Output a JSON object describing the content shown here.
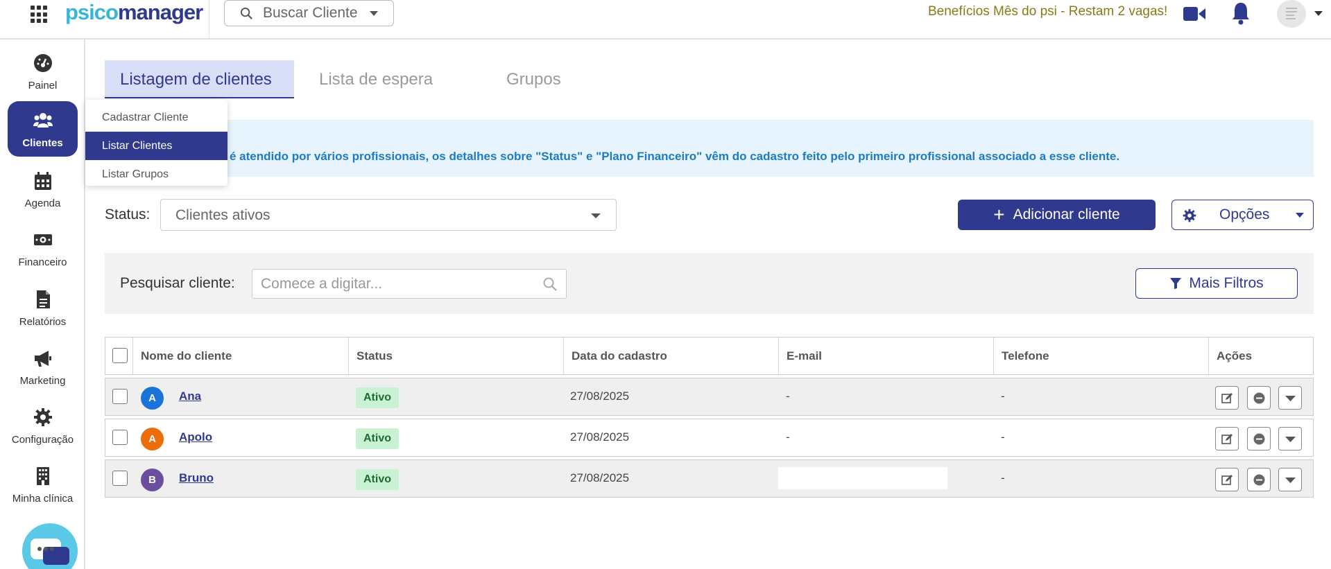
{
  "header": {
    "logo_main": "psico",
    "logo_rest": "manager",
    "search_client_label": "Buscar Cliente",
    "promo_text": "Benefícios Mês do psi - Restam 2 vagas!"
  },
  "sidebar": {
    "items": [
      {
        "label": "Painel",
        "icon": "dashboard-icon"
      },
      {
        "label": "Clientes",
        "icon": "users-icon"
      },
      {
        "label": "Agenda",
        "icon": "calendar-icon"
      },
      {
        "label": "Financeiro",
        "icon": "money-icon"
      },
      {
        "label": "Relatórios",
        "icon": "report-icon"
      },
      {
        "label": "Marketing",
        "icon": "megaphone-icon"
      },
      {
        "label": "Configuração",
        "icon": "gear-icon"
      },
      {
        "label": "Minha clínica",
        "icon": "building-icon"
      }
    ]
  },
  "dropdown": {
    "items": [
      "Cadastrar Cliente",
      "Listar Clientes",
      "Listar Grupos"
    ]
  },
  "tabs": [
    "Listagem de clientes",
    "Lista de espera",
    "Grupos"
  ],
  "banner": {
    "text": "é atendido por vários profissionais, os detalhes sobre \"Status\" e \"Plano Financeiro\" vêm do cadastro feito pelo primeiro profissional associado a esse cliente."
  },
  "filters": {
    "status_label": "Status:",
    "status_value": "Clientes ativos",
    "add_button": "Adicionar cliente",
    "options_button": "Opções",
    "search_label": "Pesquisar cliente:",
    "search_placeholder": "Comece a digitar...",
    "more_filters_button": "Mais Filtros"
  },
  "table": {
    "columns": [
      "Nome do cliente",
      "Status",
      "Data do cadastro",
      "E-mail",
      "Telefone",
      "Ações"
    ],
    "rows": [
      {
        "initial": "A",
        "name": "Ana",
        "status": "Ativo",
        "date": "27/08/2025",
        "email": "-",
        "phone": "-",
        "avatar_color": "#1a73d9"
      },
      {
        "initial": "A",
        "name": "Apolo",
        "status": "Ativo",
        "date": "27/08/2025",
        "email": "-",
        "phone": "-",
        "avatar_color": "#ec6d0a"
      },
      {
        "initial": "B",
        "name": "Bruno",
        "status": "Ativo",
        "date": "27/08/2025",
        "email": "",
        "phone": "-",
        "avatar_color": "#6b4ea0"
      }
    ]
  },
  "colors": {
    "brand": "#2f3a8f",
    "accent": "#38b6d8",
    "promo": "#8a7a17",
    "banner_text": "#1d7bc2",
    "badge_bg": "#c8f2d2"
  }
}
